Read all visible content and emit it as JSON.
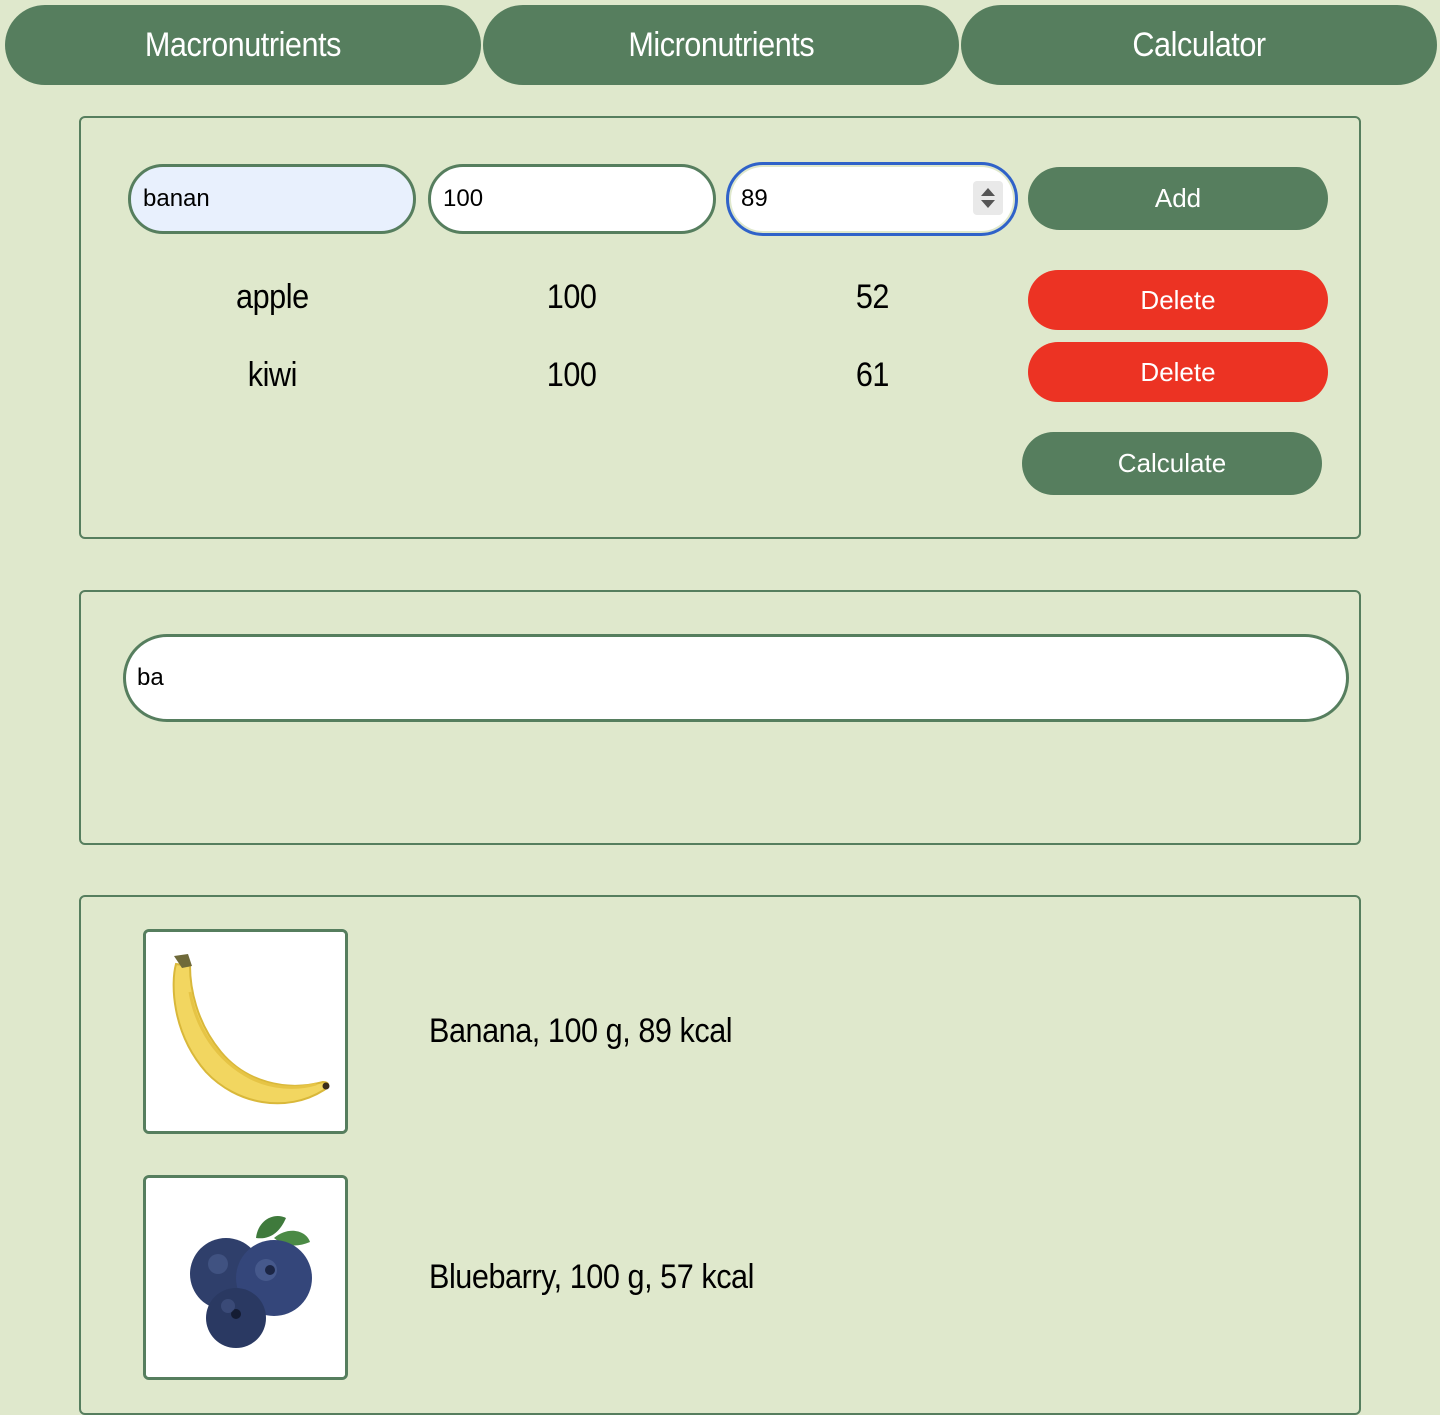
{
  "nav": {
    "tabs": [
      {
        "label": "Macronutrients"
      },
      {
        "label": "Micronutrients"
      },
      {
        "label": "Calculator"
      }
    ]
  },
  "calculator": {
    "inputs": {
      "name_value": "banan",
      "weight_value": "100",
      "kcal_value": "89"
    },
    "add_label": "Add",
    "rows": [
      {
        "name": "apple",
        "weight": "100",
        "kcal": "52",
        "delete_label": "Delete"
      },
      {
        "name": "kiwi",
        "weight": "100",
        "kcal": "61",
        "delete_label": "Delete"
      }
    ],
    "calculate_label": "Calculate"
  },
  "search": {
    "value": "ba"
  },
  "results": [
    {
      "label": "Banana, 100 g, 89 kcal",
      "icon": "banana-image"
    },
    {
      "label": "Bluebarry, 100 g, 57 kcal",
      "icon": "blueberry-image"
    }
  ],
  "colors": {
    "background": "#dfe8cc",
    "primary_green": "#567e5e",
    "delete_red": "#ec3323",
    "focus_blue": "#2f62c9",
    "autofill_blue": "#e8f0fd"
  }
}
